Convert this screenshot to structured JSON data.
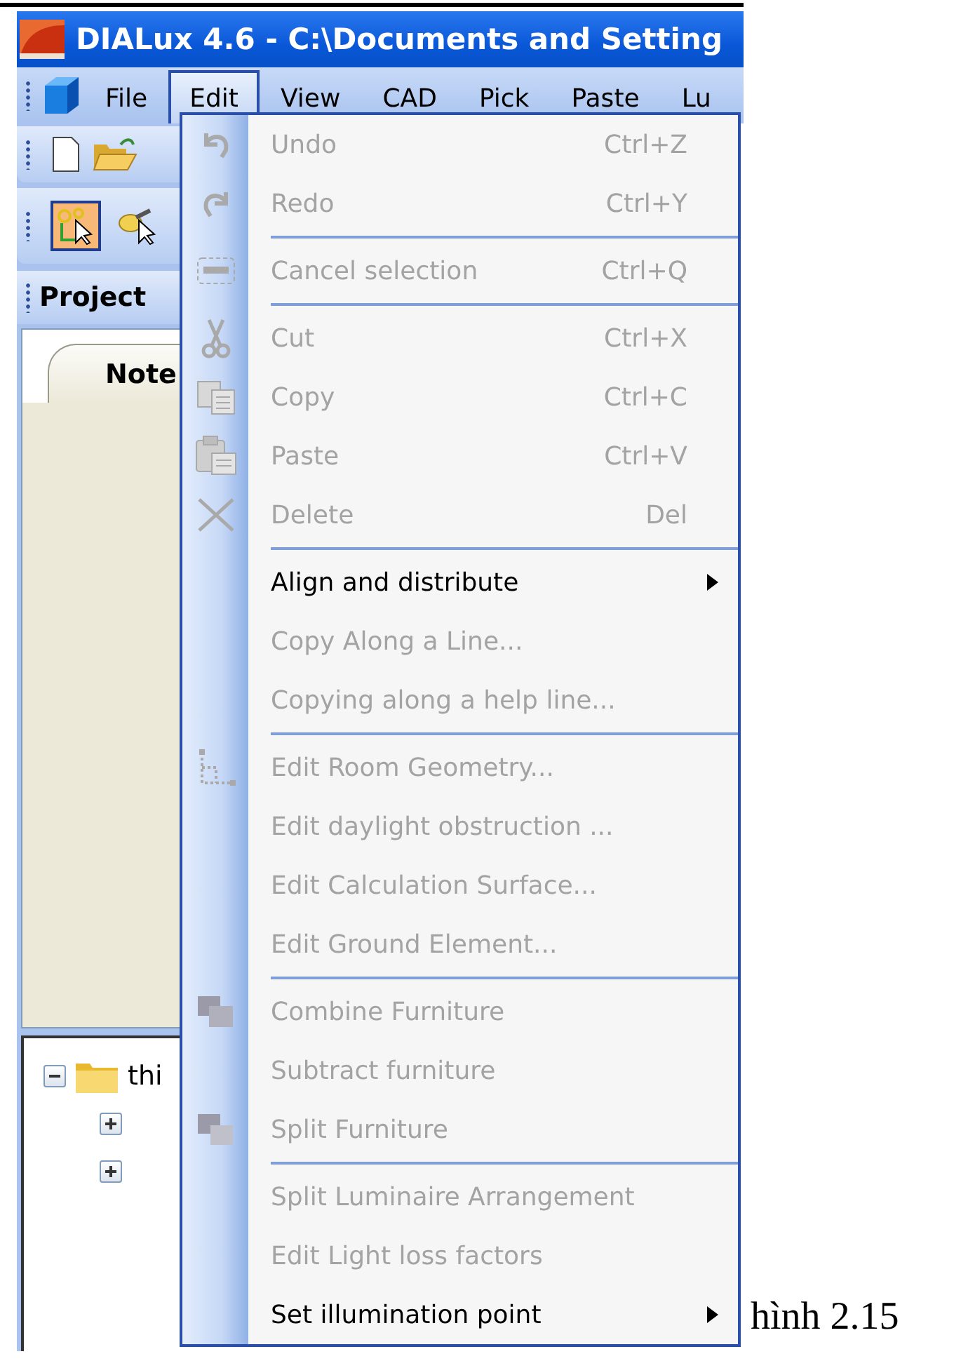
{
  "window": {
    "title": "DIALux 4.6 - C:\\Documents and Setting"
  },
  "menu_bar": [
    {
      "label": "File",
      "selected": false
    },
    {
      "label": "Edit",
      "selected": true
    },
    {
      "label": "View",
      "selected": false
    },
    {
      "label": "CAD",
      "selected": false
    },
    {
      "label": "Pick",
      "selected": false
    },
    {
      "label": "Paste",
      "selected": false
    },
    {
      "label": "Lu",
      "selected": false
    }
  ],
  "tool_buttons": [
    {
      "selected": true
    },
    {
      "selected": false
    }
  ],
  "panel": {
    "title": "Project",
    "tab": "Note"
  },
  "tree": [
    {
      "label": "thi",
      "expanded": true,
      "children": [
        {
          "expanded": false
        },
        {
          "expanded": false
        }
      ]
    }
  ],
  "menu": [
    {
      "kind": "item",
      "label": "Undo",
      "shortcut": "Ctrl+Z",
      "disabled": true,
      "submenu": false
    },
    {
      "kind": "item",
      "label": "Redo",
      "shortcut": "Ctrl+Y",
      "disabled": true,
      "submenu": false
    },
    {
      "kind": "separator"
    },
    {
      "kind": "item",
      "label": "Cancel selection",
      "shortcut": "Ctrl+Q",
      "disabled": true,
      "submenu": false
    },
    {
      "kind": "separator"
    },
    {
      "kind": "item",
      "label": "Cut",
      "shortcut": "Ctrl+X",
      "disabled": true,
      "submenu": false
    },
    {
      "kind": "item",
      "label": "Copy",
      "shortcut": "Ctrl+C",
      "disabled": true,
      "submenu": false
    },
    {
      "kind": "item",
      "label": "Paste",
      "shortcut": "Ctrl+V",
      "disabled": true,
      "submenu": false
    },
    {
      "kind": "item",
      "label": "Delete",
      "shortcut": "Del",
      "disabled": true,
      "submenu": false
    },
    {
      "kind": "separator"
    },
    {
      "kind": "item",
      "label": "Align and distribute",
      "disabled": false,
      "submenu": true
    },
    {
      "kind": "item",
      "label": "Copy Along a Line...",
      "disabled": true,
      "submenu": false
    },
    {
      "kind": "item",
      "label": "Copying along a help line...",
      "disabled": true,
      "submenu": false
    },
    {
      "kind": "separator"
    },
    {
      "kind": "item",
      "label": "Edit Room Geometry...",
      "disabled": true,
      "submenu": false
    },
    {
      "kind": "item",
      "label": "Edit daylight obstruction ...",
      "disabled": true,
      "submenu": false
    },
    {
      "kind": "item",
      "label": "Edit Calculation Surface...",
      "disabled": true,
      "submenu": false
    },
    {
      "kind": "item",
      "label": "Edit Ground Element...",
      "disabled": true,
      "submenu": false
    },
    {
      "kind": "separator"
    },
    {
      "kind": "item",
      "label": "Combine Furniture",
      "disabled": true,
      "submenu": false
    },
    {
      "kind": "item",
      "label": "Subtract furniture",
      "disabled": true,
      "submenu": false
    },
    {
      "kind": "item",
      "label": "Split Furniture",
      "disabled": true,
      "submenu": false
    },
    {
      "kind": "separator"
    },
    {
      "kind": "item",
      "label": "Split Luminaire Arrangement",
      "disabled": true,
      "submenu": false
    },
    {
      "kind": "item",
      "label": "Edit Light loss factors",
      "disabled": true,
      "submenu": false
    },
    {
      "kind": "item",
      "label": "Set illumination point",
      "disabled": false,
      "submenu": true
    }
  ],
  "caption": "hình 2.15"
}
